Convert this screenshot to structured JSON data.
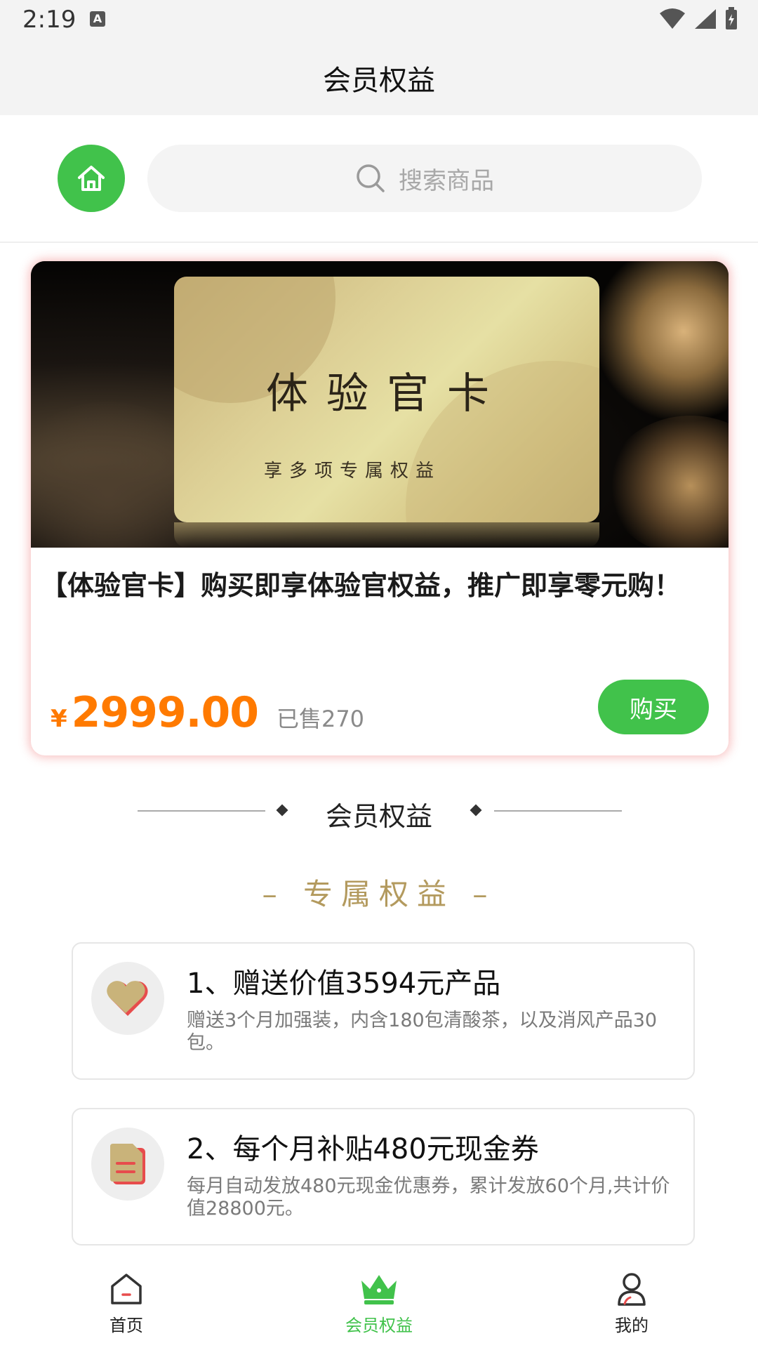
{
  "status_bar": {
    "time": "2:19",
    "notification_icon": "A"
  },
  "header": {
    "title": "会员权益"
  },
  "search": {
    "placeholder": "搜索商品"
  },
  "product": {
    "card_title": "体验官卡",
    "card_subtitle": "享多项专属权益",
    "title": "【体验官卡】购买即享体验官权益，推广即享零元购！",
    "currency": "¥",
    "price": "2999.00",
    "sold": "已售270",
    "buy_label": "购买"
  },
  "section": {
    "title": "会员权益",
    "subtitle": "– 专属权益 –"
  },
  "benefits": [
    {
      "icon": "heart-icon",
      "title": "1、赠送价值3594元产品",
      "desc": "赠送3个月加强装，内含180包清酸茶，以及消风产品30包。"
    },
    {
      "icon": "document-icon",
      "title": "2、每个月补贴480元现金券",
      "desc": "每月自动发放480元现金优惠券，累计发放60个月,共计价值28800元。"
    }
  ],
  "tabbar": {
    "items": [
      {
        "label": "首页",
        "icon": "home-icon"
      },
      {
        "label": "会员权益",
        "icon": "crown-icon",
        "active": true
      },
      {
        "label": "我的",
        "icon": "user-icon"
      }
    ]
  },
  "colors": {
    "accent": "#41c24b",
    "price": "#ff7a00",
    "gold": "#b39a5e"
  }
}
